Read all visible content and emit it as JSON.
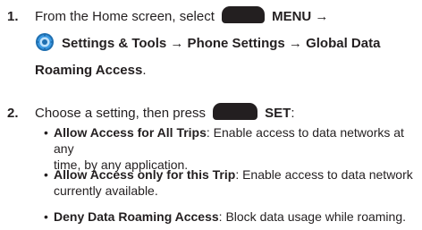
{
  "steps": [
    {
      "number": "1.",
      "line1_text": "From the Home screen, select",
      "line1_bold": "MENU →",
      "line2_bold": "Settings & Tools → Phone Settings → Global Data",
      "line3_bold": "Roaming Access",
      "line3_tail": "."
    },
    {
      "number": "2.",
      "line1_text": "Choose a setting, then press",
      "line1_bold": "SET",
      "line1_tail": ":"
    }
  ],
  "options": [
    {
      "title": "Allow Access for All Trips",
      "desc_line1": ": Enable access to data networks at any",
      "desc_line2": "time, by any application."
    },
    {
      "title": "Allow Access only for this Trip",
      "desc_line1": ": Enable access to data network",
      "desc_line2": "currently available."
    },
    {
      "title": "Deny Data Roaming Access",
      "desc_line1": ": Block data usage while roaming.",
      "desc_line2": ""
    }
  ],
  "icons": {
    "soft_key": "soft-key-button-icon",
    "settings": "settings-tools-icon"
  },
  "colors": {
    "text": "#231f20",
    "icon_blue": "#2f8fd6"
  }
}
